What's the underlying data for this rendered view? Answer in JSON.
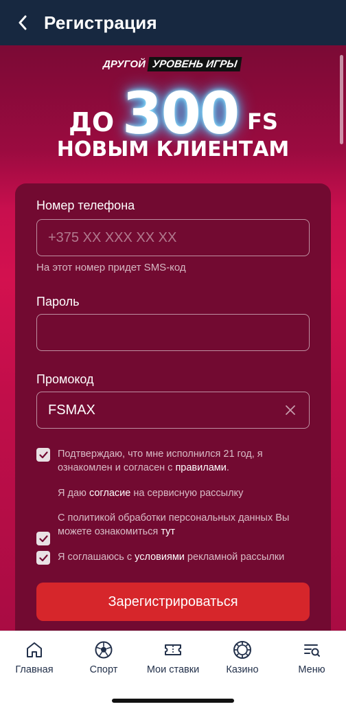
{
  "header": {
    "title": "Регистрация",
    "back_icon": "chevron-left-icon"
  },
  "promo": {
    "tag_part1": "ДРУГОЙ",
    "tag_part2": "УРОВЕНЬ ИГРЫ",
    "prefix": "ДО",
    "amount": "300",
    "unit": "FS",
    "subtitle": "НОВЫМ КЛИЕНТАМ"
  },
  "form": {
    "phone_label": "Номер телефона",
    "phone_placeholder": "+375 XX XXX XX XX",
    "phone_hint": "На этот номер придет SMS-код",
    "password_label": "Пароль",
    "password_value": "",
    "promo_label": "Промокод",
    "promo_value": "FSMAX",
    "consent_age_pre": "Подтверждаю, что мне исполнился 21 год, я ознакомлен и согласен с ",
    "consent_age_link": "правилами",
    "consent_age_post": ".",
    "consent_mail_pre": "Я даю ",
    "consent_mail_link": "согласие",
    "consent_mail_post": " на сервисную рассылку",
    "privacy_pre": "С политикой обработки персональных данных Вы можете ознакомиться ",
    "privacy_link": "тут",
    "consent_ads_pre": "Я соглашаюсь с ",
    "consent_ads_link": "условиями",
    "consent_ads_post": " рекламной рассылки",
    "submit_label": "Зарегистрироваться"
  },
  "tabbar": {
    "items": [
      {
        "label": "Главная",
        "icon": "home-icon"
      },
      {
        "label": "Спорт",
        "icon": "soccer-ball-icon"
      },
      {
        "label": "Мои ставки",
        "icon": "ticket-icon"
      },
      {
        "label": "Казино",
        "icon": "casino-chip-icon"
      },
      {
        "label": "Меню",
        "icon": "menu-search-icon"
      }
    ]
  },
  "colors": {
    "header_bg": "#172840",
    "card_bg": "#720a31",
    "accent_button": "#d6262b",
    "tab_text": "#22304a"
  }
}
